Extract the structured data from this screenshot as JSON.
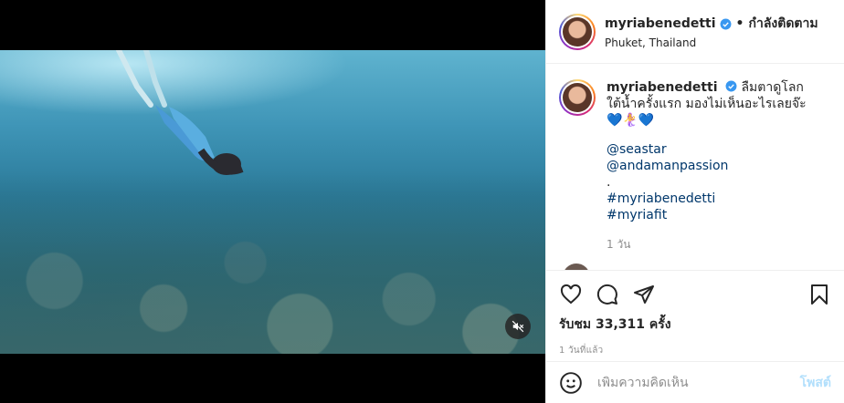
{
  "post": {
    "username": "myriabenedetti",
    "follow_status": "กำลังติดตาม",
    "dot": "•",
    "location": "Phuket, Thailand"
  },
  "caption": {
    "username": "myriabenedetti",
    "text": "ลืมตาดูโลกใต้น้ำครั้งแรก มองไม่เห็นอะไรเลยจ๊ะ 💙🧜‍♀️💙",
    "tags": [
      "@seastar",
      "@andamanpassion",
      ".",
      "#myriabenedetti",
      "#myriafit"
    ],
    "time": "1 วัน"
  },
  "stats": {
    "views": "รับชม 33,311 ครั้ง",
    "posted_ago": "1 วันที่แล้ว"
  },
  "comment_box": {
    "placeholder": "เพิ่มความคิดเห็น",
    "post_label": "โพสต์"
  },
  "colors": {
    "link": "#00376b",
    "verified": "#3897f0",
    "post_button": "#b2dffc",
    "muted": "#8e8e8e"
  },
  "icons": [
    "heart-icon",
    "comment-icon",
    "share-icon",
    "bookmark-icon",
    "emoji-icon",
    "mute-icon",
    "verified-icon"
  ]
}
